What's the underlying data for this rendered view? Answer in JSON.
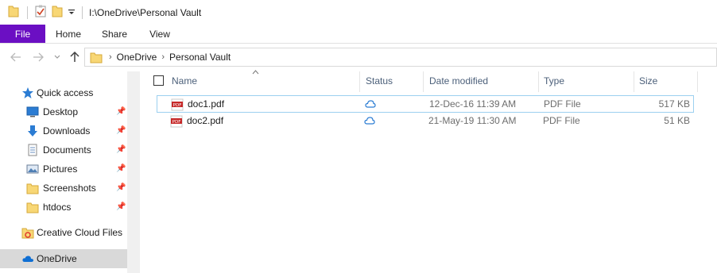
{
  "titlebar": {
    "path": "I:\\OneDrive\\Personal Vault",
    "qa_dropdown": "="
  },
  "ribbon": {
    "tabs": [
      {
        "label": "File"
      },
      {
        "label": "Home"
      },
      {
        "label": "Share"
      },
      {
        "label": "View"
      }
    ]
  },
  "address": {
    "crumbs": [
      "OneDrive",
      "Personal Vault"
    ]
  },
  "nav": {
    "quick_access": "Quick access",
    "items": [
      {
        "label": "Desktop",
        "icon": "desktop-icon",
        "pinned": true
      },
      {
        "label": "Downloads",
        "icon": "downloads-icon",
        "pinned": true
      },
      {
        "label": "Documents",
        "icon": "documents-icon",
        "pinned": true
      },
      {
        "label": "Pictures",
        "icon": "pictures-icon",
        "pinned": true
      },
      {
        "label": "Screenshots",
        "icon": "folder-icon",
        "pinned": true
      },
      {
        "label": "htdocs",
        "icon": "folder-icon",
        "pinned": true
      }
    ],
    "creative_cloud": "Creative Cloud Files",
    "onedrive": "OneDrive"
  },
  "columns": {
    "name": "Name",
    "status": "Status",
    "date": "Date modified",
    "type": "Type",
    "size": "Size"
  },
  "files": [
    {
      "name": "doc1.pdf",
      "status": "cloud-icon",
      "date": "12-Dec-16 11:39 AM",
      "type": "PDF File",
      "size": "517 KB"
    },
    {
      "name": "doc2.pdf",
      "status": "cloud-icon",
      "date": "21-May-19 11:30 AM",
      "type": "PDF File",
      "size": "51 KB"
    }
  ],
  "colors": {
    "file_tab": "#6b0fc3",
    "accent_blue": "#2b7cd3",
    "folder_yellow": "#f8d775",
    "selection_border": "#9cd0f0"
  }
}
